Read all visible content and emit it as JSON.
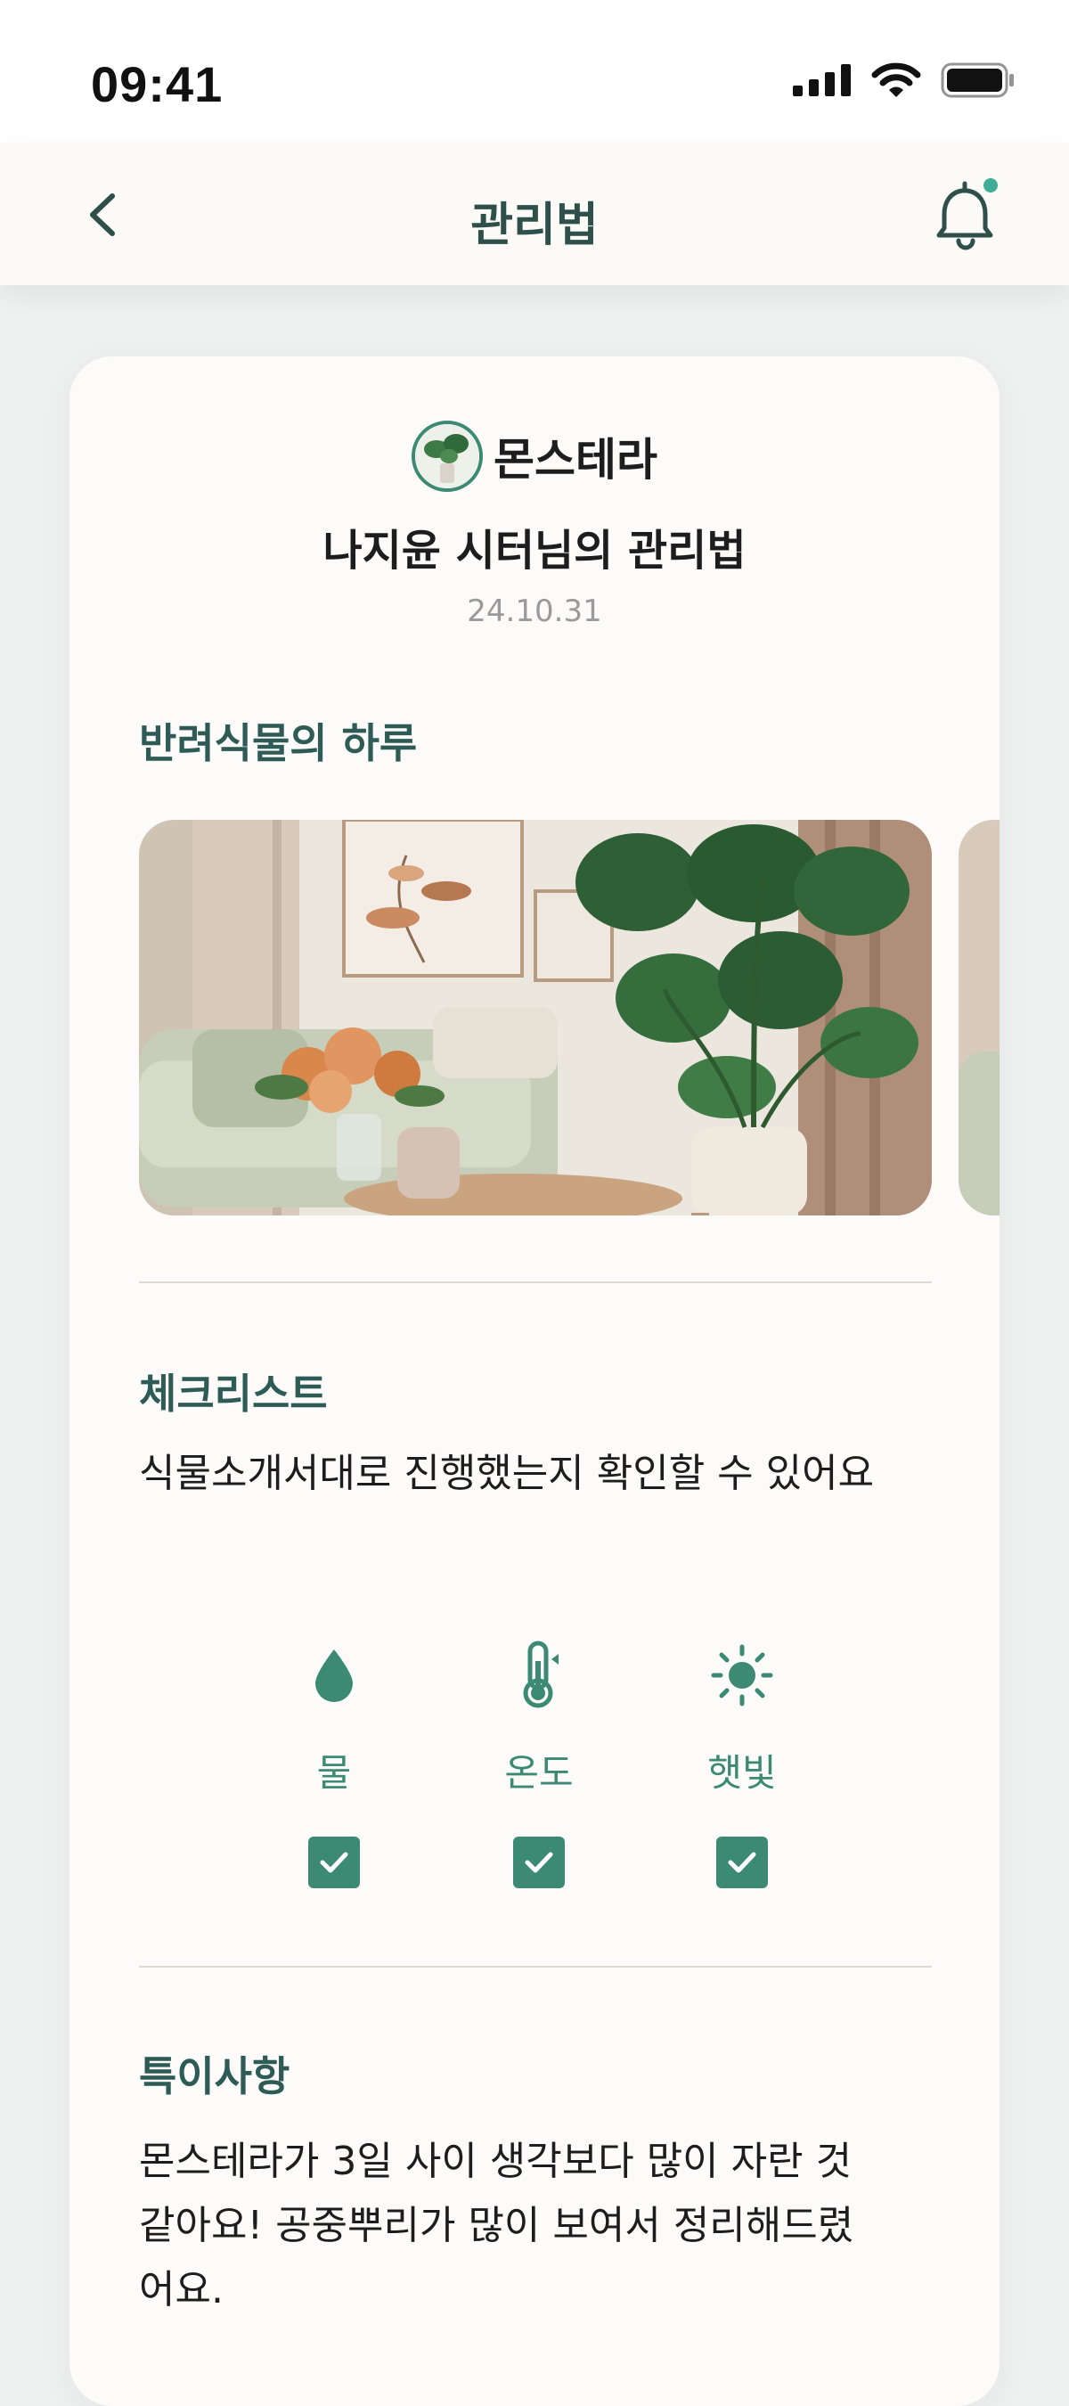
{
  "status_bar": {
    "time": "09:41"
  },
  "nav": {
    "title": "관리법"
  },
  "header": {
    "plant_name": "몬스테라",
    "guide_title": "나지윤 시터님의 관리법",
    "date": "24.10.31"
  },
  "daily": {
    "title": "반려식물의 하루"
  },
  "checklist": {
    "title": "체크리스트",
    "description": "식물소개서대로 진행했는지 확인할 수 있어요",
    "items": [
      {
        "label": "물",
        "icon": "water-drop-icon",
        "checked": true
      },
      {
        "label": "온도",
        "icon": "thermometer-icon",
        "checked": true
      },
      {
        "label": "햇빛",
        "icon": "sun-icon",
        "checked": true
      }
    ]
  },
  "notes": {
    "title": "특이사항",
    "line1": "몬스테라가 3일 사이 생각보다 많이 자란 것",
    "line2": "같아요! 공중뿌리가 많이 보여서 정리해드렸",
    "line3": "어요."
  },
  "colors": {
    "accent": "#3c8a74",
    "title": "#2e5b55",
    "background": "#fcfbf9"
  }
}
